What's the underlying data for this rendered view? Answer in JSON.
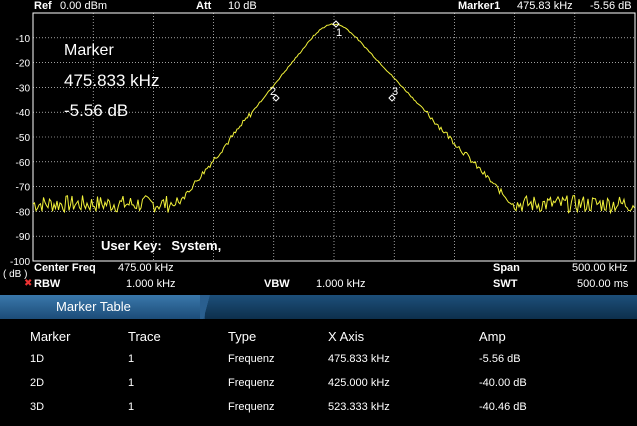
{
  "header": {
    "ref_label": "Ref",
    "ref_value": "0.00 dBm",
    "att_label": "Att",
    "att_value": "10 dB",
    "marker_label": "Marker1",
    "marker_freq": "475.83 kHz",
    "marker_amp": "-5.56 dB"
  },
  "yaxis": {
    "ticks": [
      "-10",
      "-20",
      "-30",
      "-40",
      "-50",
      "-60",
      "-70",
      "-80",
      "-90",
      "-100"
    ],
    "unit": "( dB )"
  },
  "overlay": {
    "title": "Marker",
    "freq": "475.833 kHz",
    "amp": "-5.56 dB"
  },
  "user_key": {
    "label": "User Key:",
    "value": "System,"
  },
  "trace_markers": [
    "1",
    "2",
    "3"
  ],
  "settings": {
    "center_label": "Center Freq",
    "center_value": "475.00 kHz",
    "span_label": "Span",
    "span_value": "500.00 kHz",
    "rbw_label": "RBW",
    "rbw_value": "1.000 kHz",
    "vbw_label": "VBW",
    "vbw_value": "1.000 kHz",
    "swt_label": "SWT",
    "swt_value": "500.00 ms"
  },
  "marker_table": {
    "tab_label": "Marker Table",
    "columns": [
      "Marker",
      "Trace",
      "Type",
      "X Axis",
      "Amp"
    ],
    "rows": [
      [
        "1D",
        "1",
        "Frequenz",
        "475.833 kHz",
        "-5.56 dB"
      ],
      [
        "2D",
        "1",
        "Frequenz",
        "425.000 kHz",
        "-40.00 dB"
      ],
      [
        "3D",
        "1",
        "Frequenz",
        "523.333 kHz",
        "-40.46 dB"
      ]
    ]
  },
  "colors": {
    "trace": "#f2f23a",
    "grid": "#ffffff",
    "table_header": "#2a5f8f"
  }
}
